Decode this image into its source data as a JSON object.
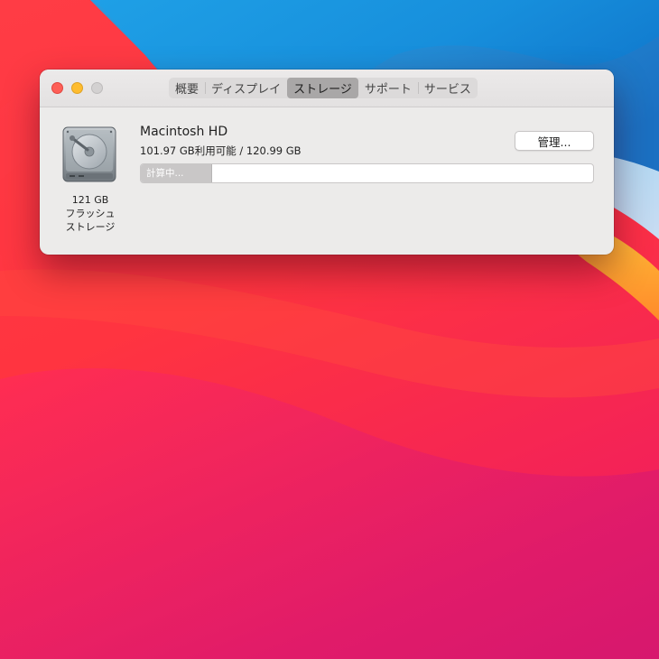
{
  "window": {
    "tabs": [
      {
        "label": "概要"
      },
      {
        "label": "ディスプレイ"
      },
      {
        "label": "ストレージ",
        "active": true
      },
      {
        "label": "サポート"
      },
      {
        "label": "サービス"
      }
    ]
  },
  "drive": {
    "icon": "hard-drive-icon",
    "caption_line1": "121 GB",
    "caption_line2": "フラッシュ",
    "caption_line3": "ストレージ"
  },
  "volume": {
    "name": "Macintosh HD",
    "usage": "101.97 GB利用可能 / 120.99 GB",
    "manage_label": "管理...",
    "bar_label": "計算中...",
    "bar_fill_percent": 15.5
  },
  "colors": {
    "close": "#fe5f57",
    "minimize": "#febc2e",
    "zoom_inactive": "#d3d1d1",
    "active_tab": "#a9a7a7"
  }
}
